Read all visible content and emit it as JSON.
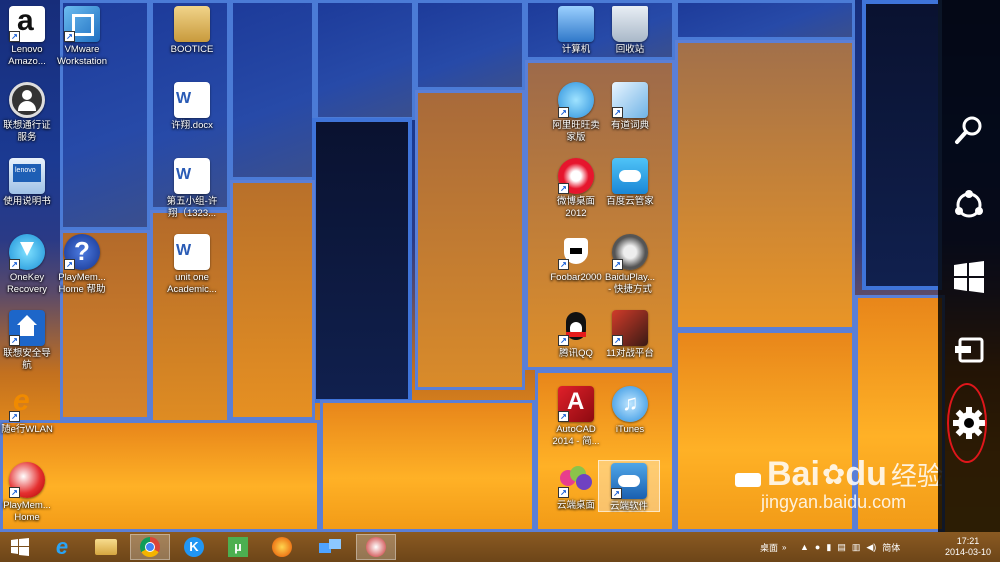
{
  "desktop_icons": {
    "lenovo_amazon": "Lenovo\nAmazo...",
    "vmware": "VMware\nWorkstation",
    "bootice": "BOOTICE",
    "lenovo_pass": "联想通行证\n服务",
    "xuxiang_docx": "许翔.docx",
    "manual": "使用说明书",
    "group5": "第五小组-许\n翔（1323...",
    "onekey": "OneKey\nRecovery",
    "playmem_help": "PlayMem...\nHome 帮助",
    "unit_one": "unit one\nAcademic...",
    "lenovo_nav": "联想安全导\n航",
    "suiexing": "随e行WLAN",
    "playmem_home": "PlayMem...\nHome",
    "computer": "计算机",
    "recycle": "回收站",
    "aliww": "阿里旺旺卖\n家版",
    "youdao": "有道词典",
    "weibo": "微博桌面\n2012",
    "baiduyun": "百度云管家",
    "foobar": "Foobar2000",
    "baiduplayer": "BaiduPlay...\n- 快捷方式",
    "qq": "腾讯QQ",
    "game11": "11对战平台",
    "autocad": "AutoCAD\n2014 - 简...",
    "itunes": "iTunes",
    "cloud_desktop": "云端桌面",
    "cloud_soft": "云端软件"
  },
  "watermark": {
    "brand": "Bai",
    "brand2": "du",
    "jingyan": "经验",
    "url": "jingyan.baidu.com"
  },
  "tray": {
    "desktop_label": "桌面",
    "ime": "简体",
    "time": "17:21",
    "date": "2014-03-10"
  },
  "colors": {
    "charm_highlight": "#e0161b",
    "taskbar": "#7a4e1d"
  }
}
